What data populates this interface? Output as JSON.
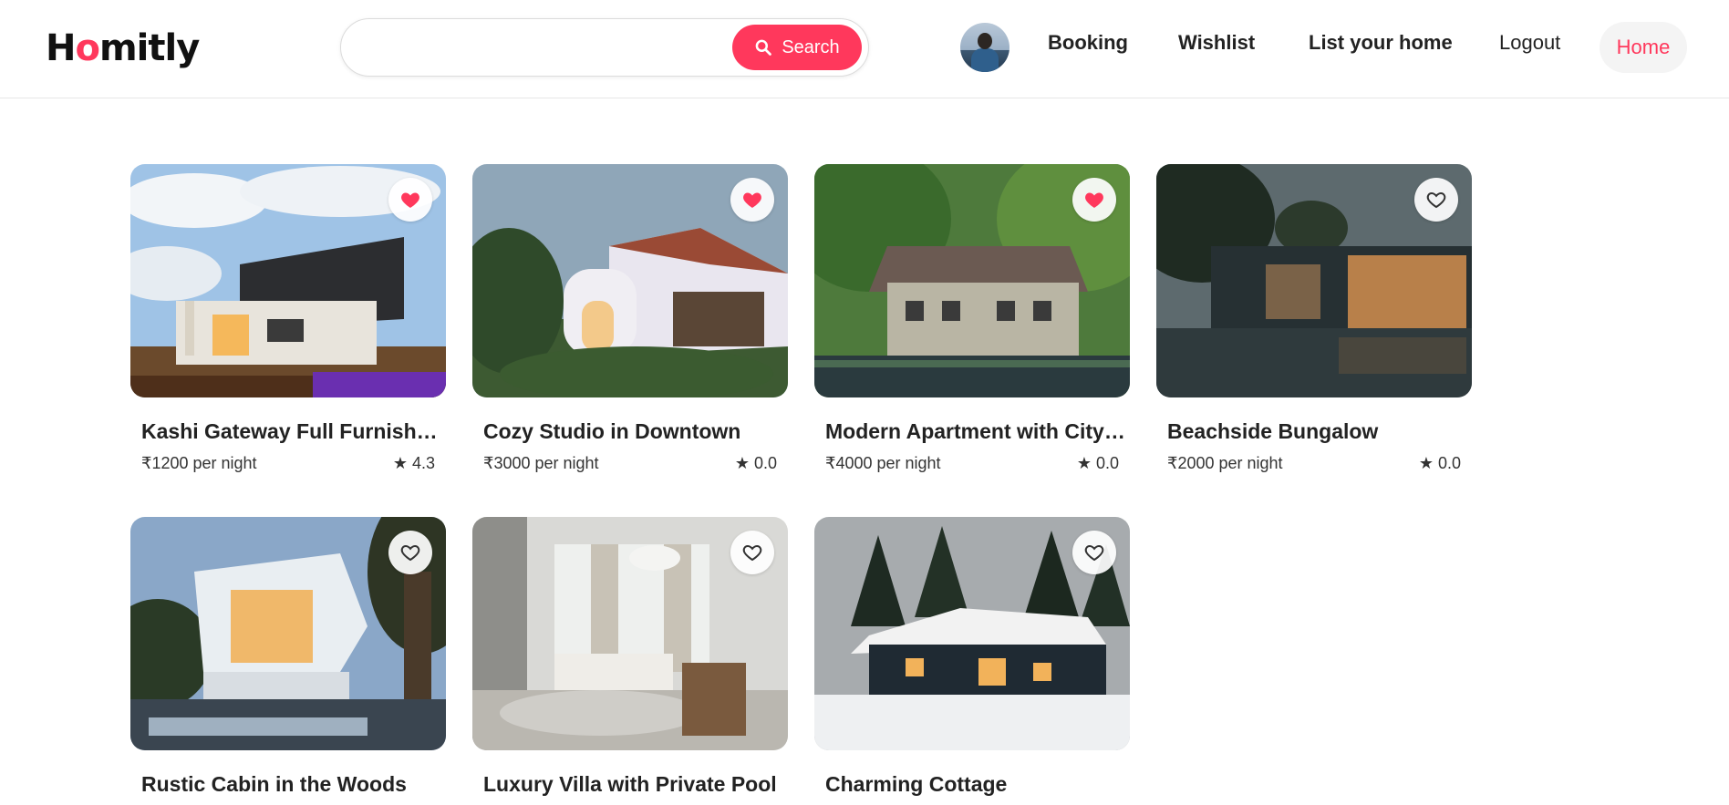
{
  "header": {
    "logo_prefix": "H",
    "logo_accent": "o",
    "logo_suffix": "mitly",
    "search_placeholder": "",
    "search_button": "Search",
    "nav": {
      "booking": "Booking",
      "wishlist": "Wishlist",
      "list_home": "List your home",
      "logout": "Logout",
      "home": "Home"
    }
  },
  "colors": {
    "accent": "#ff385c",
    "text": "#222222"
  },
  "listings": [
    {
      "title": "Kashi Gateway Full Furnished Villa",
      "price": "₹1200 per night",
      "rating": "★ 4.3",
      "wishlisted": true
    },
    {
      "title": "Cozy Studio in Downtown",
      "price": "₹3000 per night",
      "rating": "★ 0.0",
      "wishlisted": true
    },
    {
      "title": "Modern Apartment with City View",
      "price": "₹4000 per night",
      "rating": "★ 0.0",
      "wishlisted": true
    },
    {
      "title": "Beachside Bungalow",
      "price": "₹2000 per night",
      "rating": "★ 0.0",
      "wishlisted": false
    },
    {
      "title": "Rustic Cabin in the Woods",
      "price": "",
      "rating": "",
      "wishlisted": false
    },
    {
      "title": "Luxury Villa with Private Pool",
      "price": "",
      "rating": "",
      "wishlisted": false
    },
    {
      "title": "Charming Cottage",
      "price": "",
      "rating": "",
      "wishlisted": false
    }
  ]
}
